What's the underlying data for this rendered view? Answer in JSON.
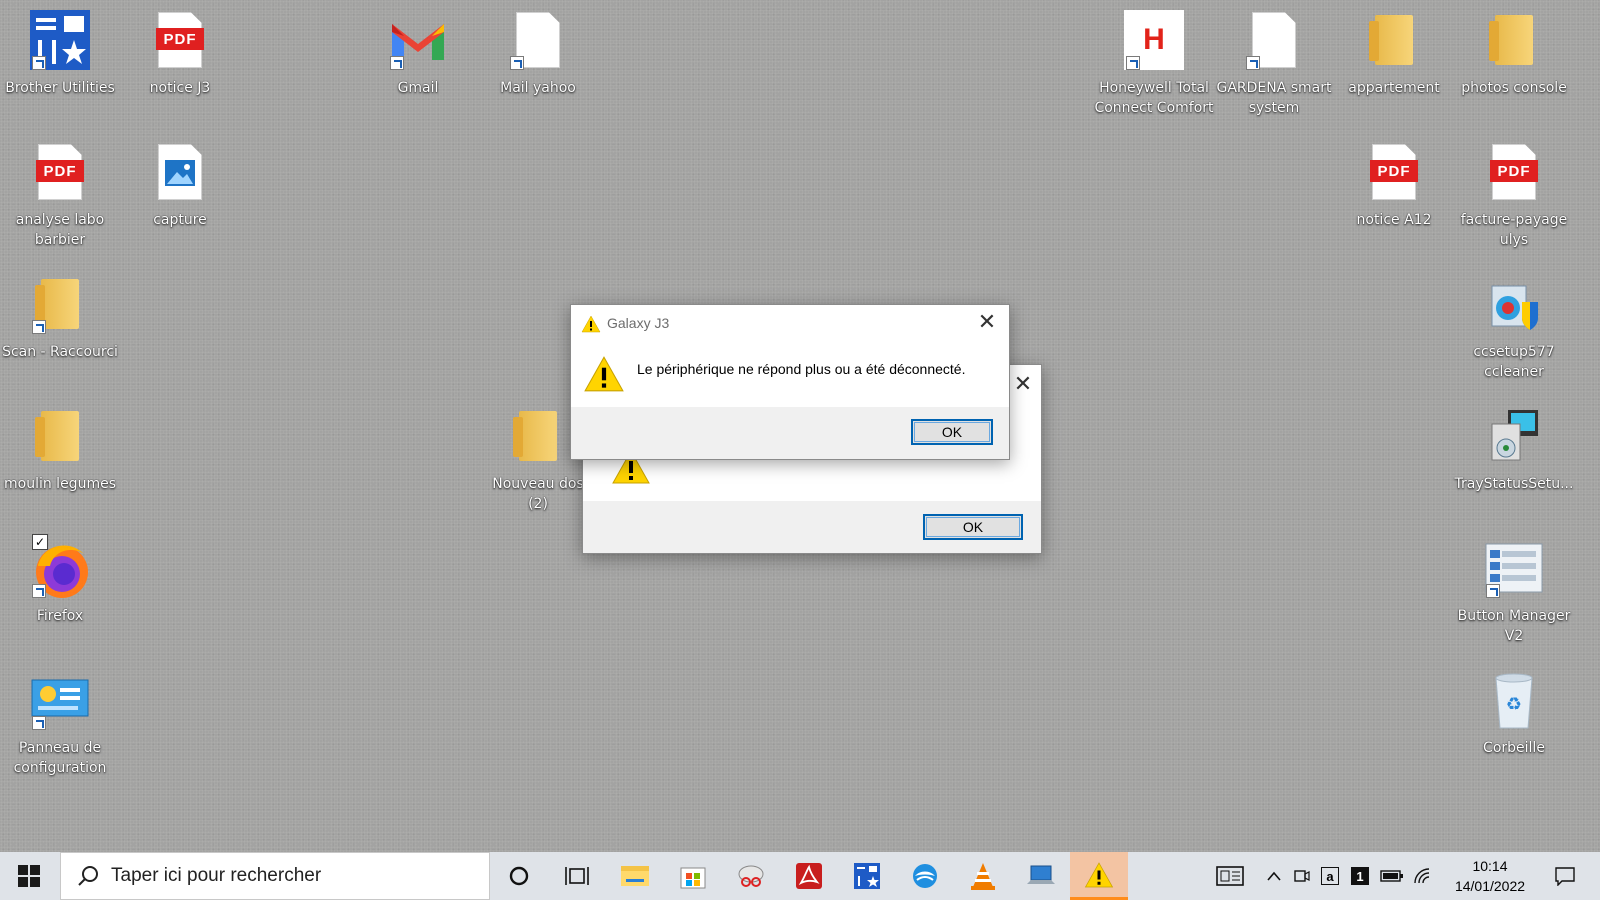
{
  "desktop_icons": {
    "brother_utilities": "Brother Utilities",
    "notice_j3": "notice J3",
    "gmail": "Gmail",
    "mail_yahoo": "Mail yahoo",
    "honeywell": "Honeywell Total Connect Comfort",
    "gardena": "GARDENA smart system",
    "appartement": "appartement",
    "photos_console": "photos console",
    "analyse_labo": "analyse labo barbier",
    "capture": "capture",
    "notice_a12": "notice A12",
    "facture": "facture-payage ulys",
    "scan": "Scan - Raccourci",
    "ccsetup": "ccsetup577 ccleaner",
    "moulin": "moulin legumes",
    "nouveau_dossier": "Nouveau dos (2)",
    "traystatus": "TrayStatusSetu...",
    "firefox": "Firefox",
    "button_manager": "Button Manager V2",
    "panneau": "Panneau de configuration",
    "corbeille": "Corbeille"
  },
  "pdf_tag": "PDF",
  "dialog_front": {
    "title": "Galaxy J3",
    "message": "Le périphérique ne répond plus ou a été déconnecté.",
    "ok_label": "OK"
  },
  "dialog_back": {
    "ok_label": "OK"
  },
  "taskbar": {
    "search_placeholder": "Taper ici pour rechercher",
    "time": "10:14",
    "date": "14/01/2022"
  },
  "colors": {
    "accent": "#0063b1",
    "warning": "#ffd400",
    "taskbar": "#dfe3e8"
  }
}
